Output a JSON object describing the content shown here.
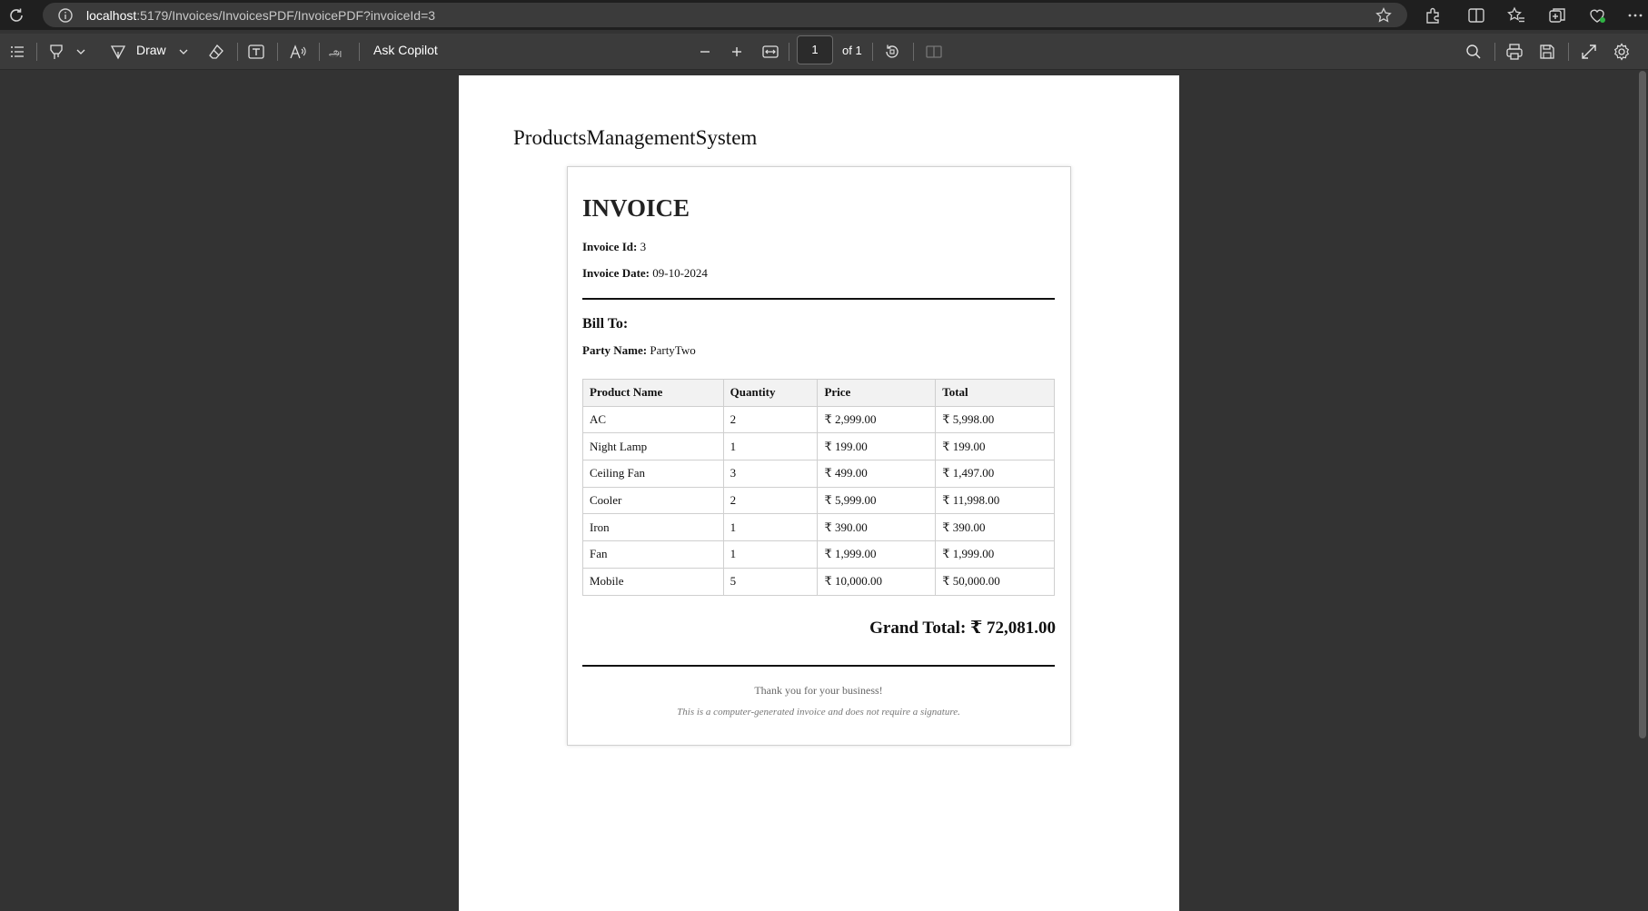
{
  "browser": {
    "url_host": "localhost",
    "url_path": ":5179/Invoices/InvoicesPDF/InvoicePDF?invoiceId=3"
  },
  "pdf_toolbar": {
    "draw_label": "Draw",
    "ask_copilot_label": "Ask Copilot",
    "page_number": "1",
    "page_of": "of 1"
  },
  "document": {
    "site_title": "ProductsManagementSystem",
    "invoice_title": "INVOICE",
    "invoice_id_label": "Invoice Id:",
    "invoice_id_value": "3",
    "invoice_date_label": "Invoice Date:",
    "invoice_date_value": "09-10-2024",
    "bill_to_label": "Bill To:",
    "party_name_label": "Party Name:",
    "party_name_value": "PartyTwo",
    "table": {
      "headers": [
        "Product Name",
        "Quantity",
        "Price",
        "Total"
      ],
      "rows": [
        [
          "AC",
          "2",
          "₹ 2,999.00",
          "₹ 5,998.00"
        ],
        [
          "Night Lamp",
          "1",
          "₹ 199.00",
          "₹ 199.00"
        ],
        [
          "Ceiling Fan",
          "3",
          "₹ 499.00",
          "₹ 1,497.00"
        ],
        [
          "Cooler",
          "2",
          "₹ 5,999.00",
          "₹ 11,998.00"
        ],
        [
          "Iron",
          "1",
          "₹ 390.00",
          "₹ 390.00"
        ],
        [
          "Fan",
          "1",
          "₹ 1,999.00",
          "₹ 1,999.00"
        ],
        [
          "Mobile",
          "5",
          "₹ 10,000.00",
          "₹ 50,000.00"
        ]
      ]
    },
    "grand_total": "Grand Total: ₹ 72,081.00",
    "thanks": "Thank you for your business!",
    "note": "This is a computer-generated invoice and does not require a signature."
  }
}
